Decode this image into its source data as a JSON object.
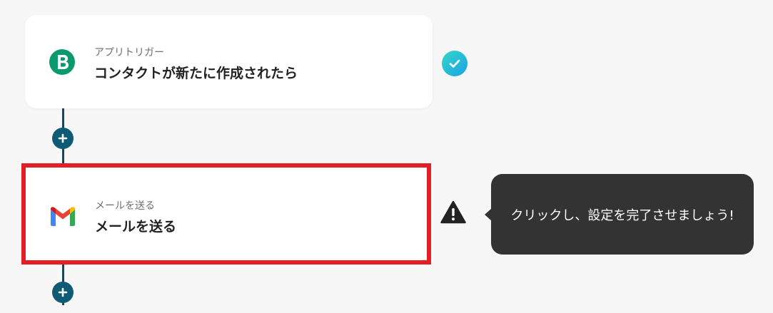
{
  "flow": {
    "steps": [
      {
        "caption": "アプリトリガー",
        "title": "コンタクトが新たに作成されたら",
        "app_icon": "brevo-icon",
        "status_icon": "check-icon",
        "highlighted": false
      },
      {
        "caption": "メールを送る",
        "title": "メールを送る",
        "app_icon": "gmail-icon",
        "status_icon": "warning-icon",
        "highlighted": true
      }
    ],
    "add_button_icon": "plus-icon"
  },
  "tooltip": {
    "text": "クリックし、設定を完了させましょう!"
  },
  "colors": {
    "background": "#f7f7f7",
    "connector": "#0f4c64",
    "add_button": "#0f5a75",
    "highlight_border": "#e41e26",
    "check_gradient_start": "#35d6c6",
    "check_gradient_end": "#1aa3e8",
    "brevo_green": "#0b996e",
    "tooltip_bg": "#333333"
  }
}
